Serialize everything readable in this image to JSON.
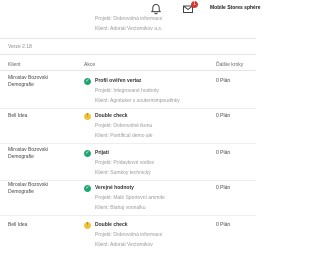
{
  "header": {
    "user_name": "Mobile Stores sphère",
    "notification_count": "1",
    "top_ghost_lines": [
      "Projekt: Dobrovolná informace",
      "Klient: Adorial Vectornikov a.s."
    ]
  },
  "page_label": "Verze 2.18",
  "table": {
    "headers": [
      "Klient",
      "Akce",
      "Ďalšie kroky"
    ],
    "rows": [
      {
        "client": "Miroslav Bozovski Demografie",
        "status": "Profil ověřen vertaz",
        "status_kind": "ok",
        "details": [
          "Projekt: Integrované hodnoty",
          "Klient: Agrstuker s souterinimpoudinky"
        ],
        "hours": "0 Plán"
      },
      {
        "client": "Bell Idea",
        "status": "Double check",
        "status_kind": "warn",
        "details": [
          "Projekt: Dobrovolné ikonu",
          "Klient: Pontifical demo ale"
        ],
        "hours": "0 Plán"
      },
      {
        "client": "Miroslav Bozovski Demografie",
        "status": "Prijatí",
        "status_kind": "ok",
        "details": [
          "Projekt: Prídavkové vodice",
          "Klient: Sumkoy technický"
        ],
        "hours": "0 Plán"
      },
      {
        "client": "Miroslav Bozovski Demografie",
        "status": "Verejné hodnoty",
        "status_kind": "ok",
        "details": [
          "Projekt: Malé Sportovní ammite",
          "Klient: Blahaj vonnalku"
        ],
        "hours": "0 Plán"
      },
      {
        "client": "Bell Idea",
        "status": "Double check",
        "status_kind": "warn",
        "details": [
          "Projekt: Dobrovolná informace",
          "Klient: Adorial Vectornikov"
        ],
        "hours": "0 Plán"
      }
    ]
  },
  "icons": {
    "bell": "bell-icon",
    "mail": "mail-icon",
    "ok": "check-circle-icon",
    "warn": "warning-icon"
  },
  "colors": {
    "ok": "#1ea672",
    "warn": "#f0c23a",
    "badge": "#d9342b"
  }
}
